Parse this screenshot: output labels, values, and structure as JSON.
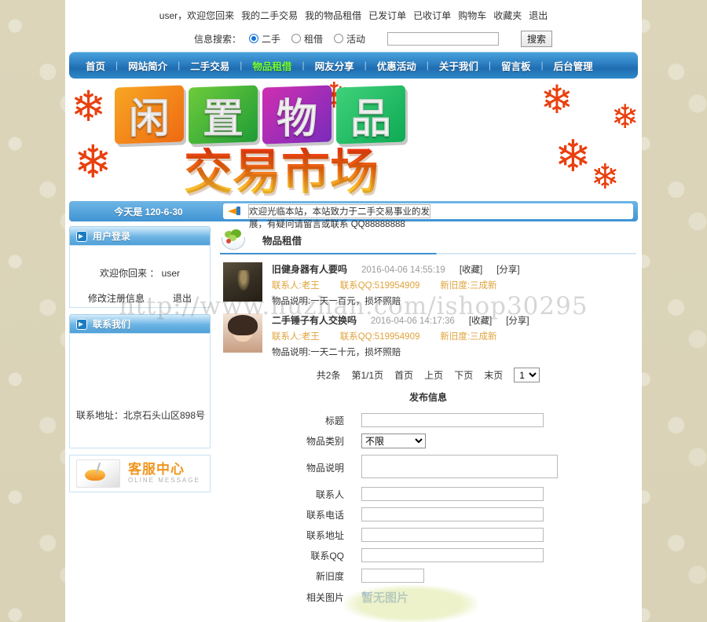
{
  "topbar": {
    "welcome": "user，欢迎您回来",
    "links": [
      "我的二手交易",
      "我的物品租借",
      "已发订单",
      "已收订单",
      "购物车",
      "收藏夹",
      "退出"
    ]
  },
  "search": {
    "label": "信息搜索：",
    "options": [
      "二手",
      "租借",
      "活动"
    ],
    "selected": "二手",
    "value": "",
    "placeholder": "",
    "button": "搜索"
  },
  "nav": {
    "items": [
      "首页",
      "网站简介",
      "二手交易",
      "物品租借",
      "网友分享",
      "优惠活动",
      "关于我们",
      "留言板",
      "后台管理"
    ],
    "active": "物品租借",
    "separator": "|",
    "active_color": "#74ff2a"
  },
  "banner": {
    "row1": [
      "闲",
      "置",
      "物",
      "品"
    ],
    "row2": "交易市场",
    "colors": [
      "#ef6a12",
      "#1f9c36",
      "#7a2bbd",
      "#0eaa54"
    ]
  },
  "notice": {
    "today": "今天是 120-6-30",
    "message": "欢迎光临本站，本站致力于二手交易事业的发展，有疑问请留言或联系 QQ88888888",
    "icon": "megaphone-icon"
  },
  "sidebar": {
    "login": {
      "title": "用户登录",
      "welcome_prefix": "欢迎你回来 ：",
      "username": "user",
      "links": [
        "修改注册信息",
        "退出"
      ]
    },
    "contact": {
      "title": "联系我们",
      "address": "联系地址：北京石头山区898号"
    },
    "service": {
      "cn": "客服中心",
      "en": "OLINE MESSAGE"
    }
  },
  "main": {
    "title": "物品租借",
    "icon": "vegetable-plate-icon",
    "items": [
      {
        "title": "旧健身器有人要吗",
        "date": "2016-04-06 14:55:19",
        "favorite": "[收藏]",
        "share": "[分享]",
        "contact_label": "联系人:",
        "contact_name": "老王",
        "qq_label": "联系QQ:",
        "qq": "519954909",
        "condition_label": "新旧度:",
        "condition": "三成新",
        "desc_label": "物品说明:",
        "desc": "一天一百元，损坏照赔",
        "thumb": "dark-photo-thumbnail"
      },
      {
        "title": "二手锤子有人交换吗",
        "date": "2016-04-06 14:17:36",
        "favorite": "[收藏]",
        "share": "[分享]",
        "contact_label": "联系人:",
        "contact_name": "老王",
        "qq_label": "联系QQ:",
        "qq": "519954909",
        "condition_label": "新旧度:",
        "condition": "三成新",
        "desc_label": "物品说明:",
        "desc": "一天二十元，损坏照赔",
        "thumb": "portrait-photo-thumbnail"
      }
    ],
    "pager": {
      "total": "共2条",
      "page": "第1/1页",
      "first": "首页",
      "prev": "上页",
      "next": "下页",
      "last": "末页",
      "select_value": "1"
    },
    "form": {
      "title": "发布信息",
      "fields": [
        {
          "label": "标题",
          "type": "text",
          "value": ""
        },
        {
          "label": "物品类别",
          "type": "select",
          "value": "不限"
        },
        {
          "label": "物品说明",
          "type": "textarea",
          "value": ""
        },
        {
          "label": "联系人",
          "type": "text",
          "value": ""
        },
        {
          "label": "联系电话",
          "type": "text",
          "value": ""
        },
        {
          "label": "联系地址",
          "type": "text",
          "value": ""
        },
        {
          "label": "联系QQ",
          "type": "text",
          "value": ""
        },
        {
          "label": "新旧度",
          "type": "text-short",
          "value": ""
        },
        {
          "label": "相关图片",
          "type": "noimage",
          "value": "暂无图片"
        }
      ]
    }
  },
  "watermark": {
    "line": "http://www.huzhan.com/ishop30295"
  }
}
